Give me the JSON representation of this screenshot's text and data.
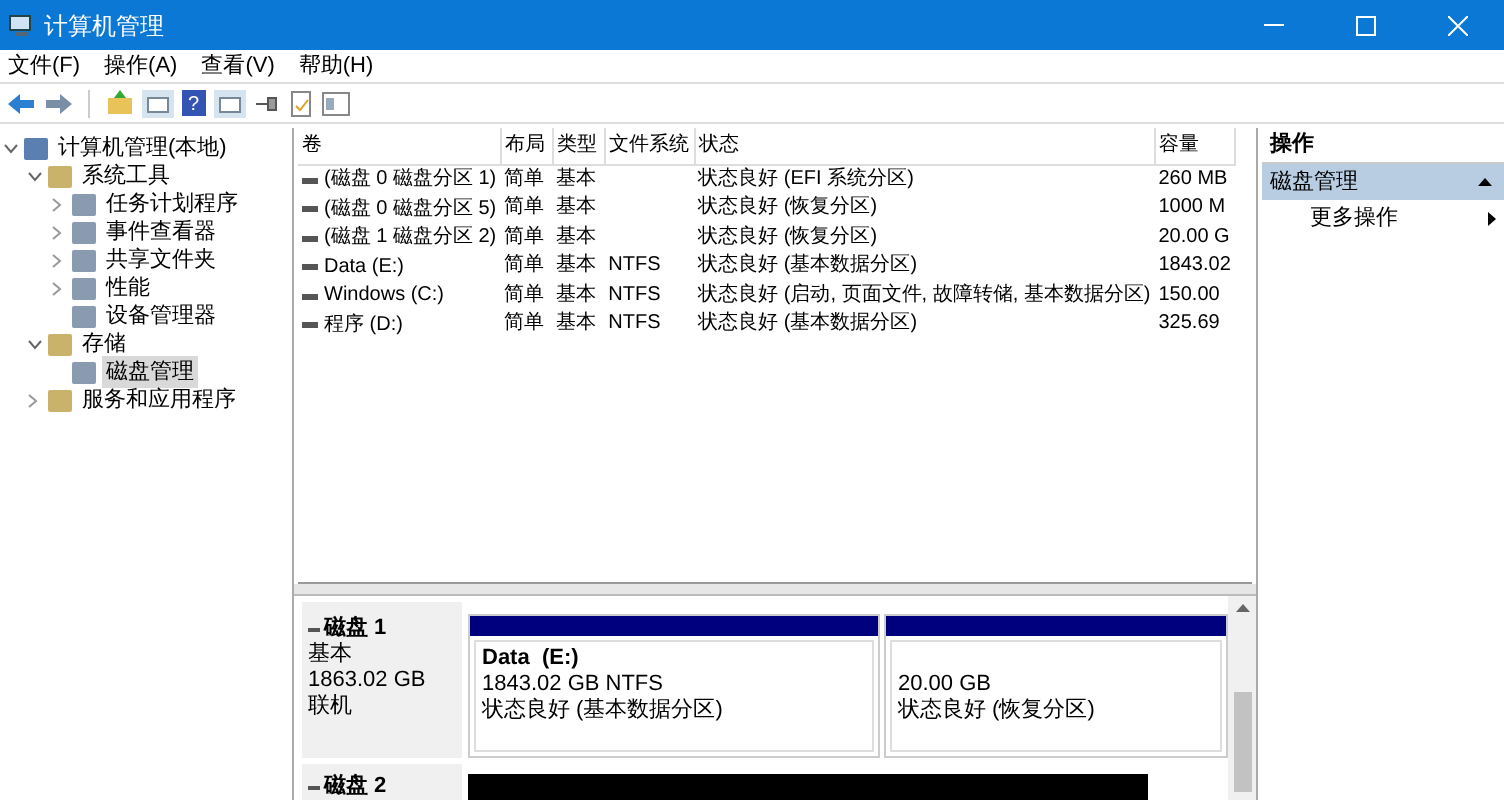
{
  "window": {
    "title": "计算机管理"
  },
  "menu": [
    "文件(F)",
    "操作(A)",
    "查看(V)",
    "帮助(H)"
  ],
  "toolbar": {
    "help_glyph": "?"
  },
  "tree": [
    {
      "label": "计算机管理(本地)",
      "expanded": true,
      "selected": false,
      "children": [
        {
          "label": "系统工具",
          "expanded": true,
          "selected": false,
          "children": [
            {
              "label": "任务计划程序",
              "expanded": false,
              "selected": false
            },
            {
              "label": "事件查看器",
              "expanded": false,
              "selected": false
            },
            {
              "label": "共享文件夹",
              "expanded": false,
              "selected": false
            },
            {
              "label": "性能",
              "expanded": false,
              "selected": false
            },
            {
              "label": "设备管理器",
              "selected": false
            }
          ]
        },
        {
          "label": "存储",
          "expanded": true,
          "selected": false,
          "children": [
            {
              "label": "磁盘管理",
              "selected": true
            }
          ]
        },
        {
          "label": "服务和应用程序",
          "expanded": false,
          "selected": false
        }
      ]
    }
  ],
  "table": {
    "columns": [
      "卷",
      "布局",
      "类型",
      "文件系统",
      "状态",
      "容量"
    ],
    "rows": [
      [
        "(磁盘 0 磁盘分区 1)",
        "简单",
        "基本",
        "",
        "状态良好 (EFI 系统分区)",
        "260 MB"
      ],
      [
        "(磁盘 0 磁盘分区 5)",
        "简单",
        "基本",
        "",
        "状态良好 (恢复分区)",
        "1000 M"
      ],
      [
        "(磁盘 1 磁盘分区 2)",
        "简单",
        "基本",
        "",
        "状态良好 (恢复分区)",
        "20.00 G"
      ],
      [
        "Data (E:)",
        "简单",
        "基本",
        "NTFS",
        "状态良好 (基本数据分区)",
        "1843.02"
      ],
      [
        "Windows (C:)",
        "简单",
        "基本",
        "NTFS",
        "状态良好 (启动, 页面文件, 故障转储, 基本数据分区)",
        "150.00"
      ],
      [
        "程序 (D:)",
        "简单",
        "基本",
        "NTFS",
        "状态良好 (基本数据分区)",
        "325.69"
      ]
    ]
  },
  "disks": [
    {
      "name": "磁盘 1",
      "lines": [
        "基本",
        "1863.02 GB",
        "联机"
      ],
      "partitions": [
        {
          "name": "Data  (E:)",
          "size": "1843.02 GB NTFS",
          "status": "状态良好 (基本数据分区)"
        },
        {
          "size": "20.00 GB",
          "status": "状态良好 (恢复分区)"
        }
      ]
    },
    {
      "name": "磁盘 2"
    }
  ],
  "actions": {
    "title": "操作",
    "section": "磁盘管理",
    "items": [
      "更多操作"
    ]
  }
}
